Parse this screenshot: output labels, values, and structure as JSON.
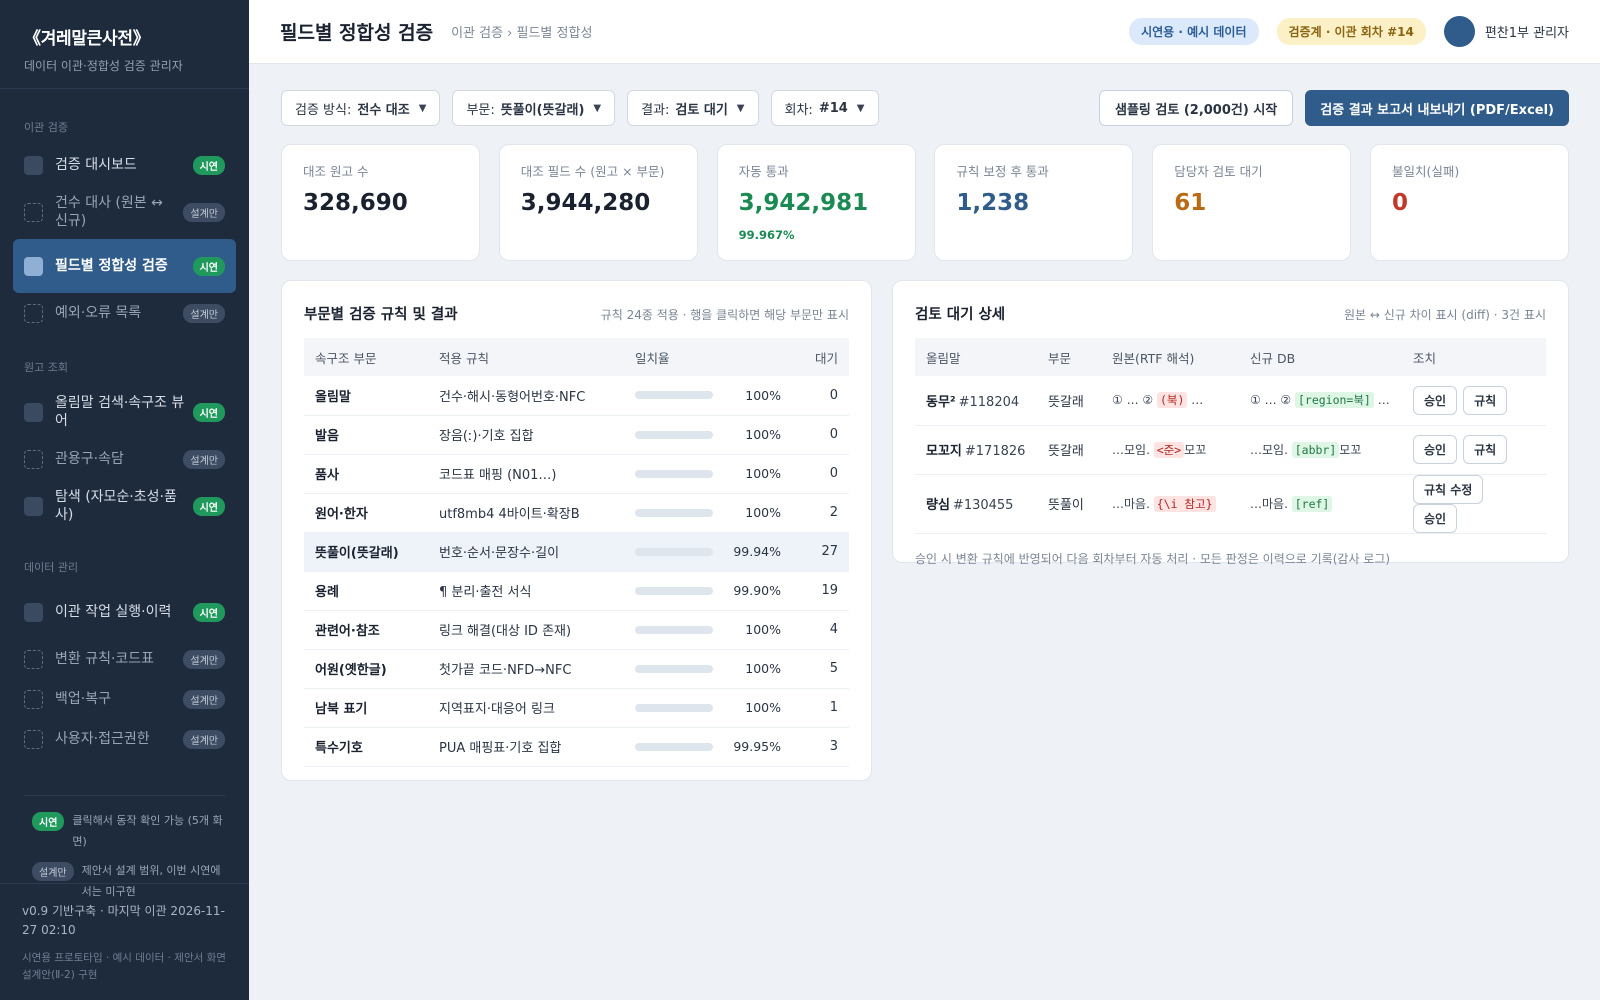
{
  "sidebar": {
    "brand_title": "《겨레말큰사전》",
    "brand_sub": "데이터 이관·정합성 검증 관리자",
    "groups": {
      "migration": "이관 검증",
      "lookup": "원고 조회",
      "data": "데이터 관리"
    },
    "items": [
      {
        "label": "검증 대시보드",
        "badge": "시연"
      },
      {
        "label": "건수 대사 (원본 ↔ 신규)",
        "badge": "설계만"
      },
      {
        "label": "필드별 정합성 검증",
        "badge": "시연"
      },
      {
        "label": "예외·오류 목록",
        "badge": "설계만"
      },
      {
        "label": "올림말 검색·속구조 뷰어",
        "badge": "시연"
      },
      {
        "label": "관용구·속담",
        "badge": "설계만"
      },
      {
        "label": "탐색 (자모순·초성·품사)",
        "badge": "시연"
      },
      {
        "label": "이관 작업 실행·이력",
        "badge": "시연"
      },
      {
        "label": "변환 규칙·코드표",
        "badge": "설계만"
      },
      {
        "label": "백업·복구",
        "badge": "설계만"
      },
      {
        "label": "사용자·접근권한",
        "badge": "설계만"
      }
    ],
    "legend": {
      "demo_badge": "시연",
      "demo_text": "클릭해서 동작 확인 가능 (5개 화면)",
      "design_badge": "설계만",
      "design_text": "제안서 설계 범위, 이번 시연에서는 미구현"
    },
    "footer_version": "v0.9 기반구축 · 마지막 이관 2026-11-27 02:10",
    "footer_note": "시연용 프로토타입 · 예시 데이터 · 제안서 화면 설계안(Ⅱ-2) 구현"
  },
  "header": {
    "title": "필드별 정합성 검증",
    "breadcrumb": "이관 검증 › 필드별 정합성",
    "pill_demo": "시연용 · 예시 데이터",
    "pill_round": "검증계 · 이관 회차 #14",
    "user": "편찬1부 관리자"
  },
  "filters": {
    "method_label": "검증 방식:",
    "method_value": "전수 대조",
    "section_label": "부문:",
    "section_value": "뜻풀이(뜻갈래)",
    "result_label": "결과:",
    "result_value": "검토 대기",
    "round_label": "회차:",
    "round_value": "#14",
    "sampling_button": "샘플링 검토 (2,000건) 시작",
    "export_button": "검증 결과 보고서 내보내기 (PDF/Excel)"
  },
  "stats": [
    {
      "label": "대조 원고 수",
      "value": "328,690",
      "tone": ""
    },
    {
      "label": "대조 필드 수 (원고 × 부문)",
      "value": "3,944,280",
      "tone": ""
    },
    {
      "label": "자동 통과",
      "value": "3,942,981",
      "tone": "green",
      "sub": "99.967%"
    },
    {
      "label": "규칙 보정 후 통과",
      "value": "1,238",
      "tone": "blue"
    },
    {
      "label": "담당자 검토 대기",
      "value": "61",
      "tone": "orange"
    },
    {
      "label": "불일치(실패)",
      "value": "0",
      "tone": "red"
    }
  ],
  "rules_panel": {
    "title": "부문별 검증 규칙 및 결과",
    "note": "규칙 24종 적용 · 행을 클릭하면 해당 부문만 표시",
    "columns": [
      "속구조 부문",
      "적용 규칙",
      "일치율",
      "대기"
    ],
    "rows": [
      {
        "section": "올림말",
        "rule": "건수·해시·동형어번호·NFC",
        "rate": 100,
        "rate_label": "100%",
        "pending": "0"
      },
      {
        "section": "발음",
        "rule": "장음(ː)·기호 집합",
        "rate": 100,
        "rate_label": "100%",
        "pending": "0"
      },
      {
        "section": "품사",
        "rule": "코드표 매핑 (N01…)",
        "rate": 100,
        "rate_label": "100%",
        "pending": "0"
      },
      {
        "section": "원어·한자",
        "rule": "utf8mb4 4바이트·확장B",
        "rate": 100,
        "rate_label": "100%",
        "pending": "2"
      },
      {
        "section": "뜻풀이(뜻갈래)",
        "rule": "번호·순서·문장수·길이",
        "rate": 99.94,
        "rate_label": "99.94%",
        "pending": "27"
      },
      {
        "section": "용례",
        "rule": "¶ 분리·출전 서식",
        "rate": 99.9,
        "rate_label": "99.90%",
        "pending": "19"
      },
      {
        "section": "관련어·참조",
        "rule": "링크 해결(대상 ID 존재)",
        "rate": 100,
        "rate_label": "100%",
        "pending": "4"
      },
      {
        "section": "어원(옛한글)",
        "rule": "첫가끝 코드·NFD→NFC",
        "rate": 100,
        "rate_label": "100%",
        "pending": "5"
      },
      {
        "section": "남북 표기",
        "rule": "지역표지·대응어 링크",
        "rate": 100,
        "rate_label": "100%",
        "pending": "1"
      },
      {
        "section": "특수기호",
        "rule": "PUA 매핑표·기호 집합",
        "rate": 99.95,
        "rate_label": "99.95%",
        "pending": "3"
      }
    ]
  },
  "detail_panel": {
    "title": "검토 대기 상세",
    "note": "원본 ↔ 신규 차이 표시 (diff) · 3건 표시",
    "columns": [
      "올림말",
      "부문",
      "원본(RTF 해석)",
      "신규 DB",
      "조치"
    ],
    "rows": [
      {
        "word": "동무²",
        "id": "#118204",
        "section": "뜻갈래",
        "orig_pre": "① … ② ",
        "orig_code": "(북)",
        "orig_post": " …",
        "new_pre": "① … ② ",
        "new_code": "[region=북]",
        "new_post": " …",
        "actions": [
          "승인",
          "규칙"
        ]
      },
      {
        "word": "모꼬지",
        "id": "#171826",
        "section": "뜻갈래",
        "orig_pre": "…모임. ",
        "orig_code": "<준>",
        "orig_post": "모꼬",
        "new_pre": "…모임. ",
        "new_code": "[abbr]",
        "new_post": "모꼬",
        "actions": [
          "승인",
          "규칙"
        ]
      },
      {
        "word": "량심",
        "id": "#130455",
        "section": "뜻풀이",
        "orig_pre": "…마음. ",
        "orig_code": "{\\i 참고}",
        "orig_post": "",
        "new_pre": "…마음. ",
        "new_code": "[ref]",
        "new_post": "",
        "actions": [
          "규칙 수정",
          "승인"
        ]
      }
    ],
    "footer": "승인 시 변환 규칙에 반영되어 다음 회차부터 자동 처리 · 모든 판정은 이력으로 기록(감사 로그)"
  },
  "colors": {
    "sidebar_bg": "#1e2b3d",
    "accent": "#2f5c8a",
    "demo_green": "#1f9a5c",
    "pass_green": "#1a8a52",
    "pending_orange": "#b96a14",
    "fail_red": "#c0392b"
  },
  "icons": {
    "dropdown": "chevron-down-icon",
    "nav_demo": "nav-square-icon",
    "nav_design": "nav-dashed-square-icon"
  }
}
